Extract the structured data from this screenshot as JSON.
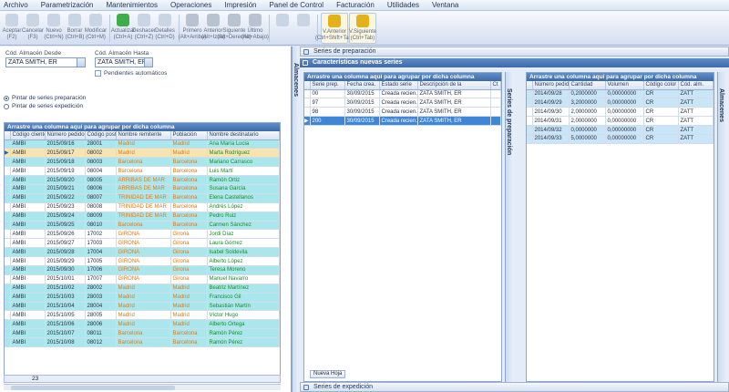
{
  "menu": [
    "Archivo",
    "Parametrización",
    "Mantenimientos",
    "Operaciones",
    "Impresión",
    "Panel de Control",
    "Facturación",
    "Utilidades",
    "Ventana"
  ],
  "toolbar": [
    {
      "label": "Aceptar (F2)",
      "color": "#c9d4e4"
    },
    {
      "label": "Cancelar (F3)",
      "color": "#c9d4e4"
    },
    {
      "label": "Nuevo (Ctrl+N)",
      "color": "#c9d4e4"
    },
    {
      "label": "Borrar (Ctrl+B)",
      "color": "#c9d4e4"
    },
    {
      "label": "Modificar (Ctrl+M)",
      "color": "#c9d4e4"
    },
    {
      "label": "Actualizar (Ctrl+A)",
      "color": "#3fae49"
    },
    {
      "label": "Deshacer (Ctrl+Z)",
      "color": "#c9d4e4"
    },
    {
      "label": "Detalles (Ctrl+D)",
      "color": "#c9d4e4"
    },
    {
      "label": "Primero (Alt+Arriba)",
      "color": "#b8c2d0"
    },
    {
      "label": "Anterior (Alt+Izda)",
      "color": "#b8c2d0"
    },
    {
      "label": "Siguiente (Alt+Derecha)",
      "color": "#b8c2d0"
    },
    {
      "label": "Último (Alt+Abajo)",
      "color": "#b8c2d0"
    },
    {
      "label": "",
      "color": "#c9d4e4"
    },
    {
      "label": "",
      "color": "#c9d4e4"
    }
  ],
  "toolbar_right": [
    {
      "label": "V.Anterior (Ctrl+Shift+Tab)",
      "color": "#e3b21a"
    },
    {
      "label": "V.Siguiente (Ctrl+Tab)",
      "color": "#e3b21a"
    }
  ],
  "filters": {
    "desde_label": "Cód. Almacén Desde",
    "desde_value": "ZATA SMITH, ER",
    "hasta_label": "Cód. Almacén Hasta",
    "hasta_value": "ZATA SMITH, ER",
    "check_label": "Pendientes automáticos"
  },
  "radios": [
    "Pintar de series preparación",
    "Pintar de series expedición"
  ],
  "left_grid": {
    "group_text": "Arrastre una columna aquí para agrupar por dicha columna",
    "columns": [
      "Código cliente",
      "Número pedido",
      "Código post.",
      "Nombre remitente",
      "Población",
      "Nombre destinatario"
    ],
    "rows": [
      {
        "style": "cyan",
        "cells": [
          "AMBI",
          "2015/09/16",
          "28001",
          "Madrid",
          "Madrid",
          "Ana María Lucia"
        ]
      },
      {
        "style": "sel",
        "cells": [
          "AMBI",
          "2015/09/17",
          "08002",
          "Madrid",
          "Madrid",
          "Marta Rodríguez"
        ]
      },
      {
        "style": "cyan",
        "cells": [
          "AMBI",
          "2015/09/18",
          "08003",
          "Barcelona",
          "Barcelona",
          "Mariano Carrasco"
        ]
      },
      {
        "style": "white",
        "cells": [
          "AMBI",
          "2015/09/19",
          "08004",
          "Barcelona",
          "Barcelona",
          "Luis Martí"
        ]
      },
      {
        "style": "cyan",
        "cells": [
          "AMBI",
          "2015/09/20",
          "08005",
          "ARRIBAS DE MAR",
          "Barcelona",
          "Ramón Ortiz"
        ]
      },
      {
        "style": "cyan",
        "cells": [
          "AMBI",
          "2015/09/21",
          "08006",
          "ARRIBAS DE MAR",
          "Barcelona",
          "Susana García"
        ]
      },
      {
        "style": "cyan",
        "cells": [
          "AMBI",
          "2015/09/22",
          "08007",
          "TRINIDAD DE MAR",
          "Barcelona",
          "Elena Castellanos"
        ]
      },
      {
        "style": "white",
        "cells": [
          "AMBI",
          "2015/09/23",
          "08008",
          "TRINIDAD DE MAR",
          "Barcelona",
          "Andrés López"
        ]
      },
      {
        "style": "cyan",
        "cells": [
          "AMBI",
          "2015/09/24",
          "08009",
          "TRINIDAD DE MAR",
          "Barcelona",
          "Pedro Ruiz"
        ]
      },
      {
        "style": "cyan",
        "cells": [
          "AMBI",
          "2015/09/25",
          "08010",
          "Barcelona",
          "Barcelona",
          "Carmen Sánchez"
        ]
      },
      {
        "style": "white",
        "cells": [
          "AMBI",
          "2015/09/26",
          "17002",
          "GIRONA",
          "Girona",
          "Jordi Díaz"
        ]
      },
      {
        "style": "white",
        "cells": [
          "AMBI",
          "2015/09/27",
          "17003",
          "GIRONA",
          "Girona",
          "Laura Gómez"
        ]
      },
      {
        "style": "cyan",
        "cells": [
          "AMBI",
          "2015/09/28",
          "17004",
          "GIRONA",
          "Girona",
          "Isabel Soldevila"
        ]
      },
      {
        "style": "white",
        "cells": [
          "AMBI",
          "2015/09/29",
          "17005",
          "GIRONA",
          "Girona",
          "Alberto López"
        ]
      },
      {
        "style": "cyan",
        "cells": [
          "AMBI",
          "2015/09/30",
          "17006",
          "GIRONA",
          "Girona",
          "Teresa Moreno"
        ]
      },
      {
        "style": "white",
        "cells": [
          "AMBI",
          "2015/10/01",
          "17007",
          "GIRONA",
          "Girona",
          "Manuel Navarro"
        ]
      },
      {
        "style": "cyan",
        "cells": [
          "AMBI",
          "2015/10/02",
          "28002",
          "Madrid",
          "Madrid",
          "Beatriz Martínez"
        ]
      },
      {
        "style": "cyan",
        "cells": [
          "AMBI",
          "2015/10/03",
          "28003",
          "Madrid",
          "Madrid",
          "Francisco Gil"
        ]
      },
      {
        "style": "cyan",
        "cells": [
          "AMBI",
          "2015/10/04",
          "28004",
          "Madrid",
          "Madrid",
          "Sebastián Martín"
        ]
      },
      {
        "style": "white",
        "cells": [
          "AMBI",
          "2015/10/05",
          "28005",
          "Madrid",
          "Madrid",
          "Víctor Hugo"
        ]
      },
      {
        "style": "cyan",
        "cells": [
          "AMBI",
          "2015/10/06",
          "28006",
          "Madrid",
          "Madrid",
          "Alberto Ortega"
        ]
      },
      {
        "style": "cyan",
        "cells": [
          "AMBI",
          "2015/10/07",
          "08011",
          "Barcelona",
          "Barcelona",
          "Ramón Pérez"
        ]
      },
      {
        "style": "cyan",
        "cells": [
          "AMBI",
          "2015/10/08",
          "08012",
          "Barcelona",
          "Barcelona",
          "Ramón Pérez"
        ]
      }
    ],
    "footer_count": "23"
  },
  "side_tab_left": "Almacenes",
  "right": {
    "section1": "Series de preparación",
    "section1_sub": "Características nuevas series",
    "side_tab_mid": "Series de preparación",
    "side_tab_right": "Almacenes",
    "section2": "Series de expedición",
    "grid_a": {
      "group_text": "Arrastre una columna aquí para agrupar por dicha columna",
      "columns": [
        "Serie prep.",
        "Fecha crea.",
        "Estado serie",
        "Descripción de la",
        "Ct"
      ],
      "rows": [
        {
          "style": "white",
          "cells": [
            "00",
            "30/09/2015",
            "Creada recien.",
            "ZATA SMITH, ER",
            ""
          ]
        },
        {
          "style": "white",
          "cells": [
            "97",
            "30/09/2015",
            "Creada recien.",
            "ZATA SMITH, ER",
            ""
          ]
        },
        {
          "style": "white",
          "cells": [
            "98",
            "30/09/2015",
            "Creada recien.",
            "ZATA SMITH, ER",
            ""
          ]
        },
        {
          "style": "blue",
          "cells": [
            "200",
            "30/09/2015",
            "Creada recien.",
            "ZATA SMITH, ER",
            ""
          ]
        }
      ],
      "button": "Nueva Hoja"
    },
    "grid_b": {
      "group_text": "Arrastre una columna aquí para agrupar por dicha columna",
      "columns": [
        "Número pedido",
        "Cantidad",
        "Volumen",
        "Código color",
        "Cód. alm."
      ],
      "rows": [
        {
          "style": "lblue",
          "cells": [
            "2014/09/28",
            "0,2000000",
            "0,00000000",
            "CR",
            "ZATT"
          ]
        },
        {
          "style": "lblue",
          "cells": [
            "2014/09/29",
            "3,2000000",
            "0,00000000",
            "CR",
            "ZATT"
          ]
        },
        {
          "style": "white",
          "cells": [
            "2014/09/30",
            "2,0000000",
            "0,00000000",
            "CR",
            "ZATT"
          ]
        },
        {
          "style": "white",
          "cells": [
            "2014/09/31",
            "2,0000000",
            "0,00000000",
            "CR",
            "ZATT"
          ]
        },
        {
          "style": "lblue",
          "cells": [
            "2014/09/32",
            "0,0000000",
            "0,00000000",
            "CR",
            "ZATT"
          ]
        },
        {
          "style": "lblue",
          "cells": [
            "2014/09/33",
            "5,0000000",
            "0,00000000",
            "CR",
            "ZATT"
          ]
        }
      ]
    }
  }
}
